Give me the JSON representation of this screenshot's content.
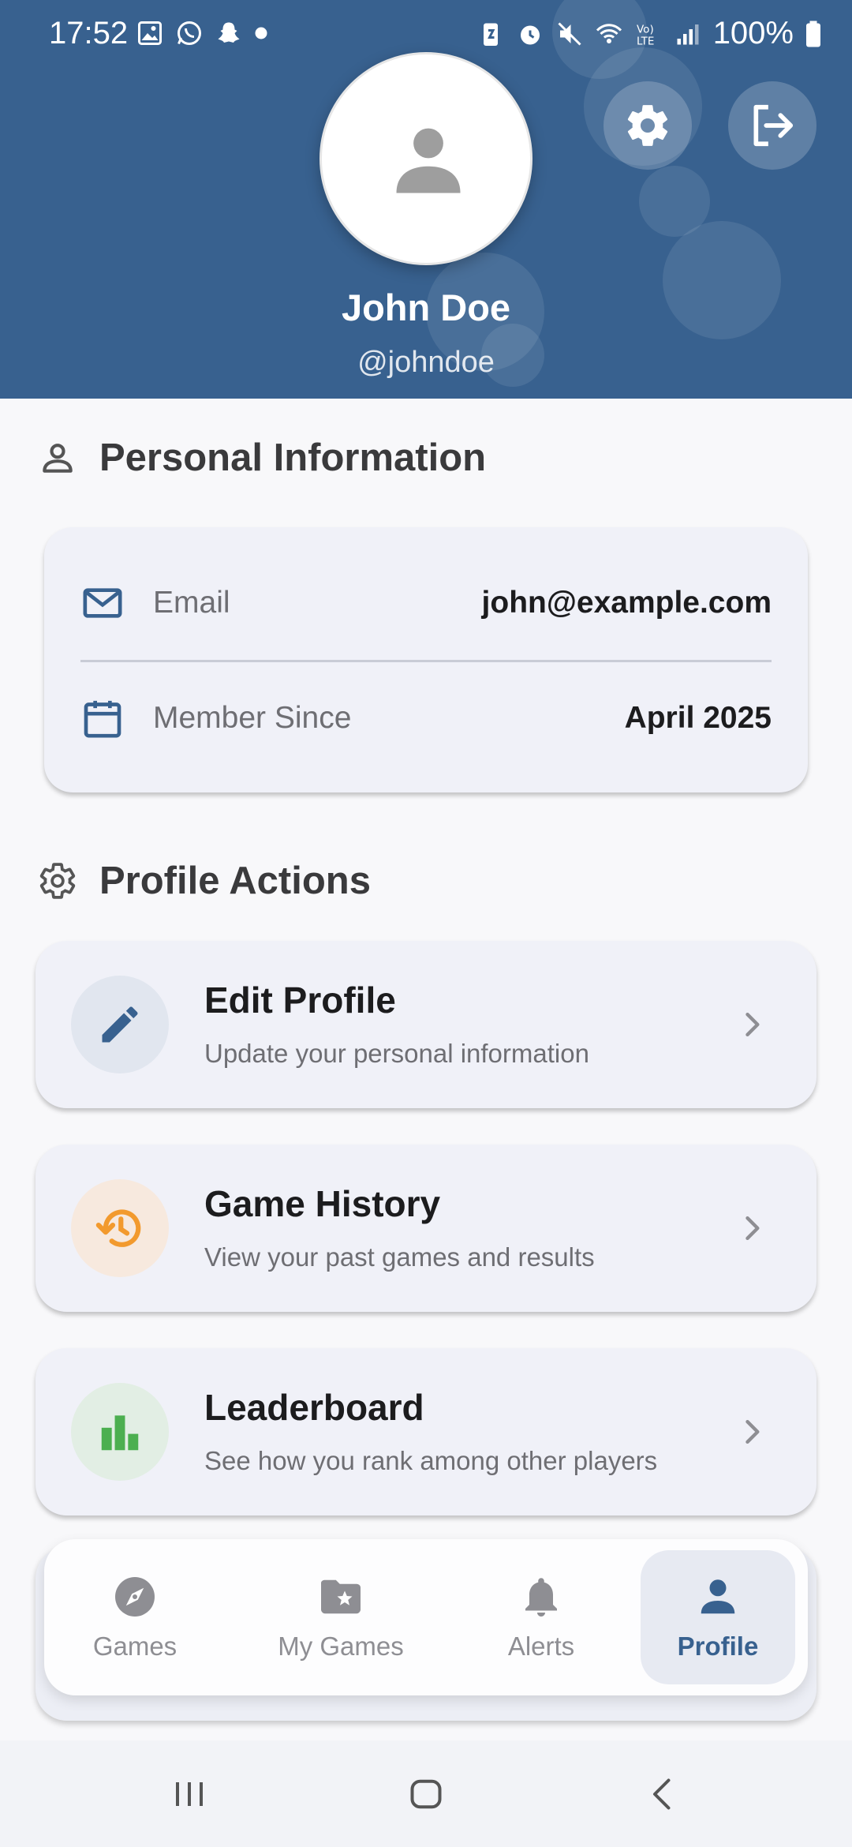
{
  "status_bar": {
    "time": "17:52",
    "battery": "100%",
    "left_icons": [
      "gallery-icon",
      "whatsapp-icon",
      "snapchat-icon",
      "dot-icon"
    ],
    "right_icons": [
      "battery-saver-icon",
      "alarm-icon",
      "mute-icon",
      "wifi-icon",
      "volte-icon",
      "signal-icon",
      "battery-icon"
    ]
  },
  "header": {
    "name": "John Doe",
    "handle": "@johndoe",
    "settings_icon": "gear-icon",
    "logout_icon": "logout-icon",
    "accent": "#38618f"
  },
  "personal_info": {
    "title": "Personal Information",
    "rows": [
      {
        "label": "Email",
        "value": "john@example.com",
        "icon": "mail-icon"
      },
      {
        "label": "Member Since",
        "value": "April 2025",
        "icon": "calendar-icon"
      }
    ]
  },
  "profile_actions": {
    "title": "Profile Actions",
    "items": [
      {
        "title": "Edit Profile",
        "subtitle": "Update your personal information",
        "icon": "pencil-icon",
        "color": "#38618f"
      },
      {
        "title": "Game History",
        "subtitle": "View your past games and results",
        "icon": "history-icon",
        "color": "#f29a2e"
      },
      {
        "title": "Leaderboard",
        "subtitle": "See how you rank among other players",
        "icon": "bar-chart-icon",
        "color": "#4caf50"
      }
    ]
  },
  "bottom_nav": {
    "items": [
      {
        "label": "Games",
        "icon": "compass-icon",
        "active": false
      },
      {
        "label": "My Games",
        "icon": "folder-star-icon",
        "active": false
      },
      {
        "label": "Alerts",
        "icon": "bell-icon",
        "active": false
      },
      {
        "label": "Profile",
        "icon": "person-icon",
        "active": true
      }
    ]
  }
}
